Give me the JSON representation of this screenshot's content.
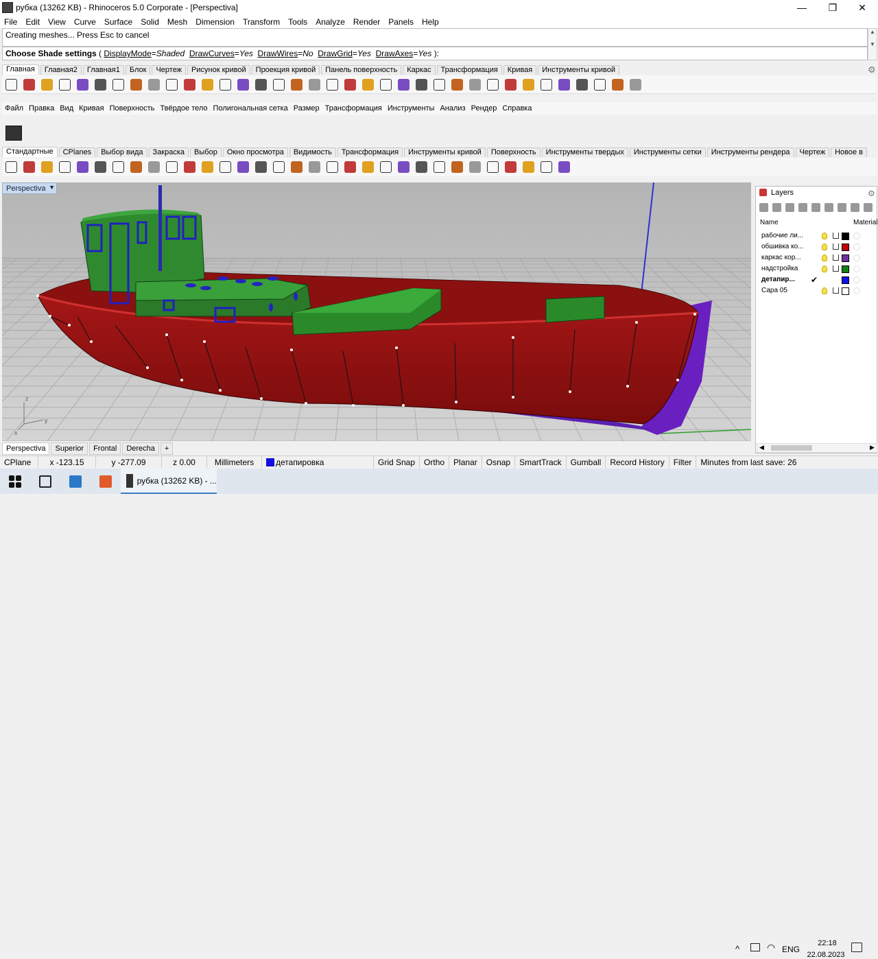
{
  "window": {
    "title": "рубка (13262 KB) - Rhinoceros  5.0 Corporate - [Perspectiva]",
    "minimize": "—",
    "maximize": "❐",
    "close": "✕"
  },
  "menu": [
    "File",
    "Edit",
    "View",
    "Curve",
    "Surface",
    "Solid",
    "Mesh",
    "Dimension",
    "Transform",
    "Tools",
    "Analyze",
    "Render",
    "Panels",
    "Help"
  ],
  "command": {
    "history": "Creating meshes... Press Esc to cancel",
    "prompt": "Choose Shade settings",
    "options": [
      {
        "key": "DisplayMode",
        "value": "Shaded"
      },
      {
        "key": "DrawCurves",
        "value": "Yes"
      },
      {
        "key": "DrawWires",
        "value": "No"
      },
      {
        "key": "DrawGrid",
        "value": "Yes"
      },
      {
        "key": "DrawAxes",
        "value": "Yes"
      }
    ],
    "end": "):"
  },
  "tabs1": [
    "Главная",
    "Главная2",
    "Главная1",
    "Блок",
    "Чертеж",
    "Рисунок кривой",
    "Проекция кривой",
    "Панель поверхность",
    "Каркас",
    "Трансформация",
    "Кривая",
    "Инструменты кривой"
  ],
  "rus_menu": [
    "Файл",
    "Правка",
    "Вид",
    "Кривая",
    "Поверхность",
    "Твёрдое тело",
    "Полигональная сетка",
    "Размер",
    "Трансформация",
    "Инструменты",
    "Анализ",
    "Рендер",
    "Справка"
  ],
  "tabs2": [
    "Стандартные",
    "CPlanes",
    "Выбор вида",
    "Закраска",
    "Выбор",
    "Окно просмотра",
    "Видимость",
    "Трансформация",
    "Инструменты кривой",
    "Поверхность",
    "Инструменты твердых",
    "Инструменты сетки",
    "Инструменты рендера",
    "Чертеж",
    "Новое в"
  ],
  "viewport": {
    "label": "Perspectiva",
    "axis_x": "x",
    "axis_y": "y",
    "axis_z": "z"
  },
  "viewport_tabs": [
    "Perspectiva",
    "Superior",
    "Frontal",
    "Derecha",
    "+"
  ],
  "layers": {
    "title": "Layers",
    "col_name": "Name",
    "col_material": "Material",
    "rows": [
      {
        "name": "рабочие ли...",
        "color": "#000000",
        "current": false
      },
      {
        "name": "обшивка ко...",
        "color": "#c00000",
        "current": false
      },
      {
        "name": "каркас кор...",
        "color": "#7030a0",
        "current": false
      },
      {
        "name": "надстройка",
        "color": "#108010",
        "current": false
      },
      {
        "name": "детапир...",
        "color": "#1010e0",
        "current": true
      },
      {
        "name": "Сара 05",
        "color": "#ffffff",
        "current": false
      }
    ]
  },
  "status": {
    "cplane": "CPlane",
    "x": "x -123.15",
    "y": "y -277.09",
    "z": "z 0.00",
    "units": "Millimeters",
    "layer": "детапировка",
    "layer_color": "#1010e0",
    "toggles": [
      "Grid Snap",
      "Ortho",
      "Planar",
      "Osnap",
      "SmartTrack",
      "Gumball",
      "Record History",
      "Filter"
    ],
    "save": "Minutes from last save: 26"
  },
  "taskbar": {
    "app": "рубка (13262 KB) - ...",
    "lang": "ENG",
    "time": "22:18",
    "date": "22.08.2023"
  }
}
